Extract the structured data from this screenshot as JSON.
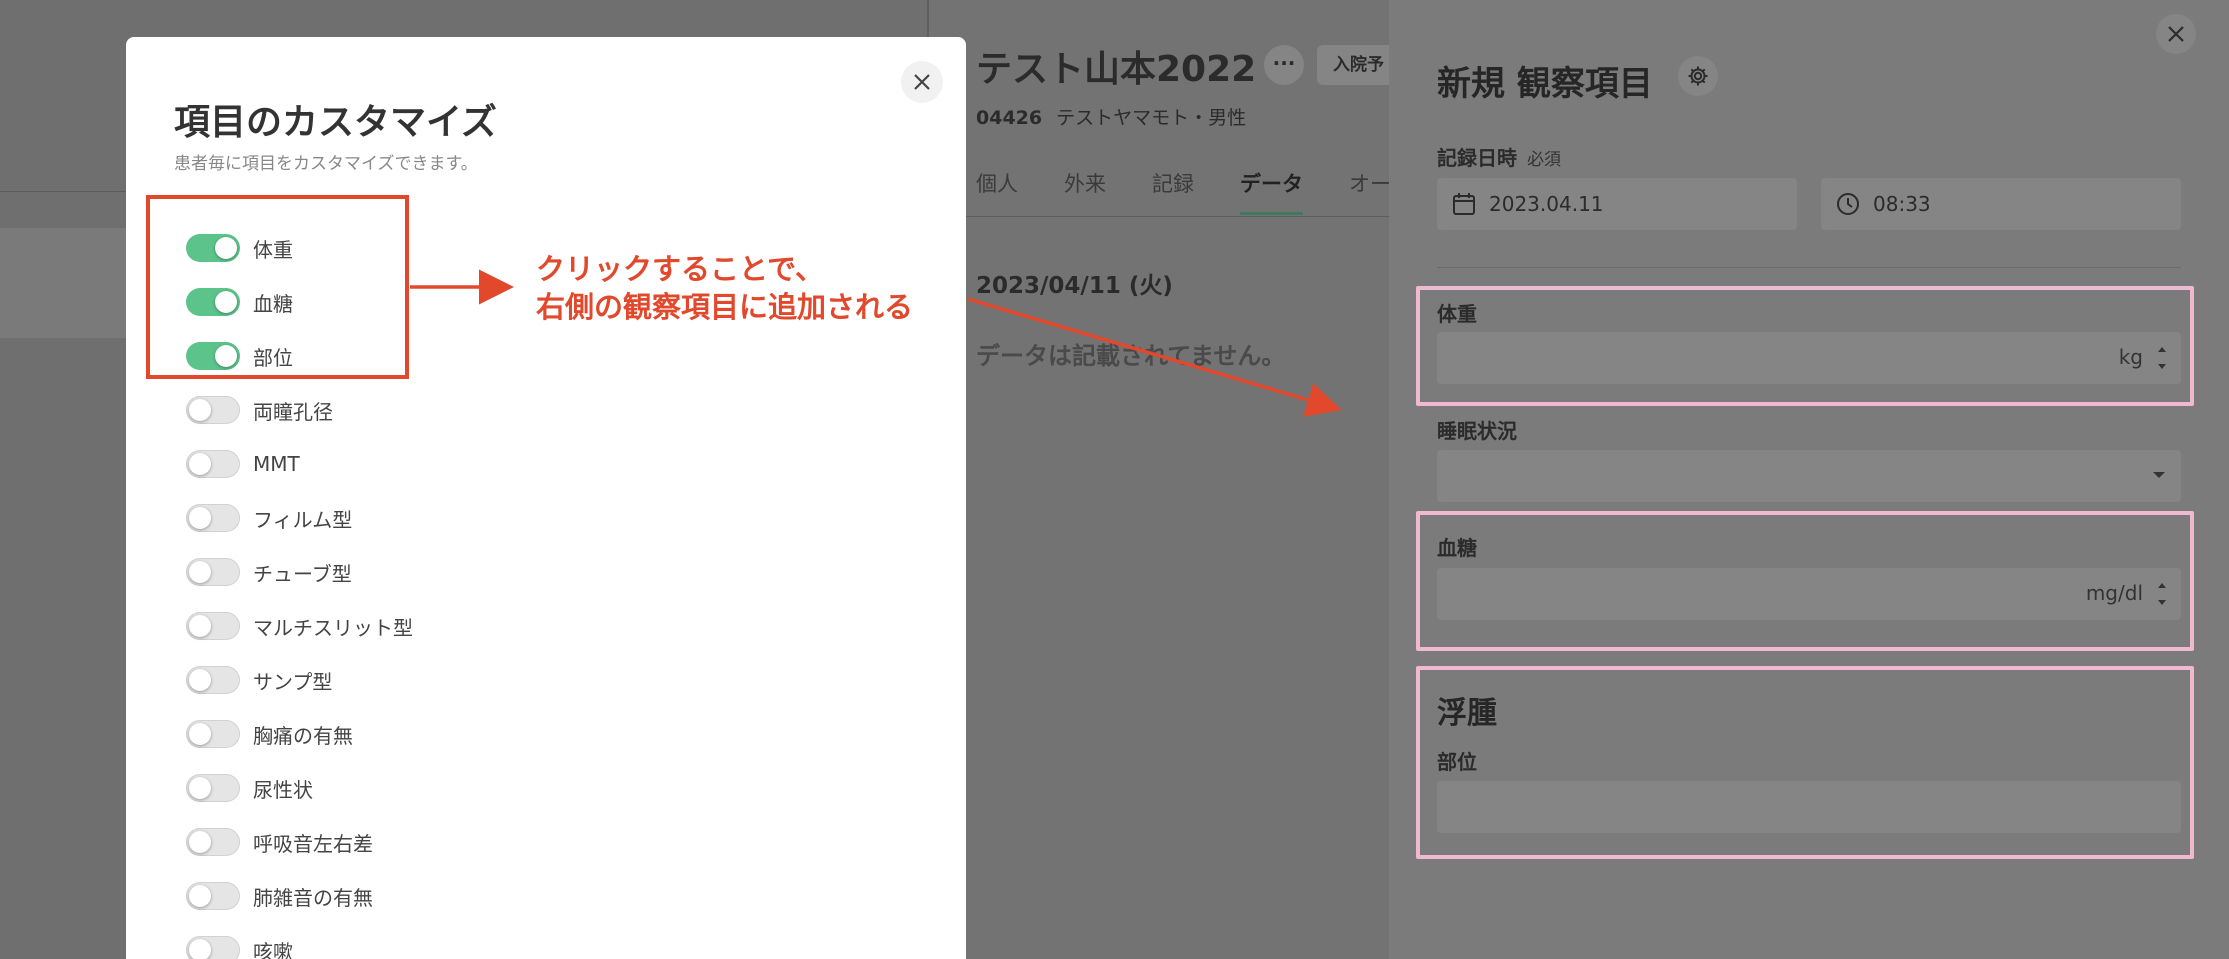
{
  "patient": {
    "name": "テスト山本2022",
    "more_label": "···",
    "admit_label": "入院予",
    "id": "04426",
    "kana_gender": "テストヤマモト・男性",
    "tabs": [
      {
        "label": "個人"
      },
      {
        "label": "外来"
      },
      {
        "label": "記録"
      },
      {
        "label": "データ",
        "active": true
      },
      {
        "label": "オー"
      }
    ],
    "date_heading": "2023/04/11 (火)",
    "no_data": "データは記載されてません。"
  },
  "modal": {
    "title": "項目のカスタマイズ",
    "subtitle": "患者毎に項目をカスタマイズできます。",
    "items": [
      {
        "label": "体重",
        "on": true
      },
      {
        "label": "血糖",
        "on": true
      },
      {
        "label": "部位",
        "on": true
      },
      {
        "label": "両瞳孔径",
        "on": false
      },
      {
        "label": "MMT",
        "on": false
      },
      {
        "label": "フィルム型",
        "on": false
      },
      {
        "label": "チューブ型",
        "on": false
      },
      {
        "label": "マルチスリット型",
        "on": false
      },
      {
        "label": "サンプ型",
        "on": false
      },
      {
        "label": "胸痛の有無",
        "on": false
      },
      {
        "label": "尿性状",
        "on": false
      },
      {
        "label": "呼吸音左右差",
        "on": false
      },
      {
        "label": "肺雑音の有無",
        "on": false
      },
      {
        "label": "咳嗽",
        "on": false
      }
    ]
  },
  "annotation": {
    "line1": "クリックすることで、",
    "line2": "右側の観察項目に追加される",
    "color": "#e2482b"
  },
  "drawer": {
    "title": "新規 観察項目",
    "record_datetime_label": "記録日時",
    "required_label": "必須",
    "date_value": "2023.04.11",
    "time_value": "08:33",
    "weight_label": "体重",
    "weight_unit": "kg",
    "sleep_label": "睡眠状況",
    "glucose_label": "血糖",
    "glucose_unit": "mg/dl",
    "edema_title": "浮腫",
    "site_label": "部位",
    "highlight_color": "#f0b9cf"
  }
}
